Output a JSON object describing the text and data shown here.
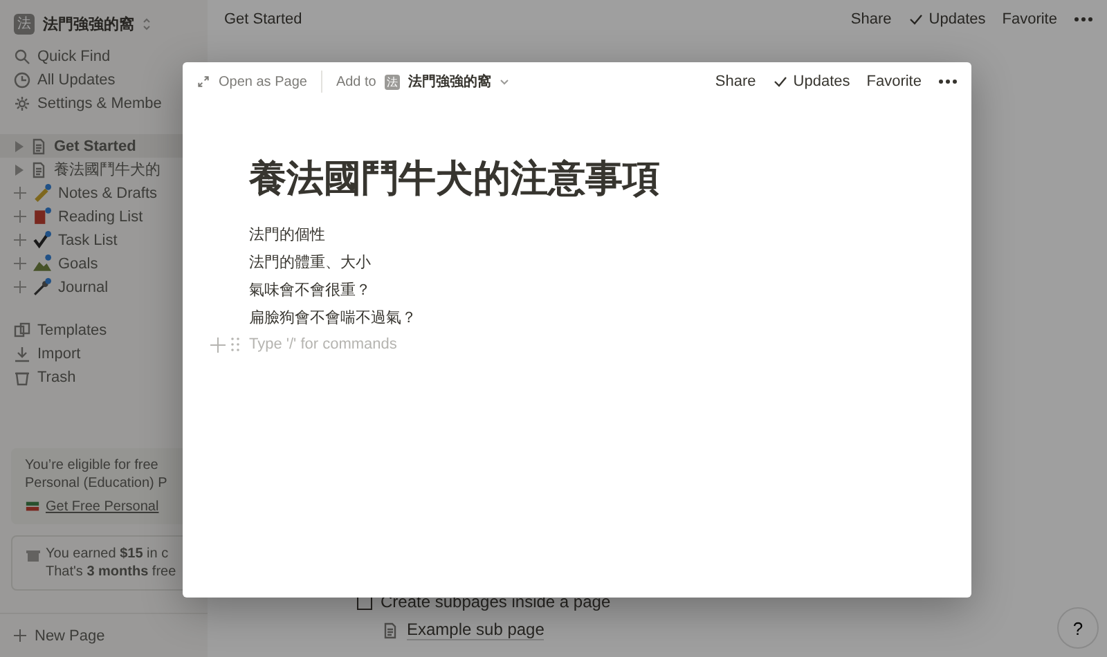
{
  "sidebar": {
    "workspace": {
      "initial": "法",
      "name": "法門強強的窩"
    },
    "nav": [
      {
        "kind": "search",
        "label": "Quick Find"
      },
      {
        "kind": "clock",
        "label": "All Updates"
      },
      {
        "kind": "gear",
        "label": "Settings & Membe"
      }
    ],
    "pages": [
      {
        "kind": "page",
        "label": "Get Started",
        "selected": true
      },
      {
        "kind": "page",
        "label": "養法國鬥牛犬的",
        "selected": false
      },
      {
        "kind": "notes",
        "label": "Notes & Drafts",
        "selected": false
      },
      {
        "kind": "books",
        "label": "Reading List",
        "selected": false
      },
      {
        "kind": "tasks",
        "label": "Task List",
        "selected": false
      },
      {
        "kind": "goals",
        "label": "Goals",
        "selected": false
      },
      {
        "kind": "journal",
        "label": "Journal",
        "selected": false
      }
    ],
    "tools": [
      {
        "kind": "templates",
        "label": "Templates"
      },
      {
        "kind": "import",
        "label": "Import"
      },
      {
        "kind": "trash",
        "label": "Trash"
      }
    ],
    "promo": {
      "lines": [
        "You’re eligible for free",
        "Personal (Education) P"
      ],
      "link": "Get Free Personal"
    },
    "credit": {
      "lines": [
        "You earned **$15** in c",
        "That's **3 months** free"
      ]
    },
    "new_page": "New Page"
  },
  "main": {
    "breadcrumb": "Get Started",
    "actions": [
      {
        "kind": "plain",
        "label": "Share"
      },
      {
        "kind": "check",
        "label": "Updates"
      },
      {
        "kind": "plain",
        "label": "Favorite"
      }
    ],
    "content": [
      {
        "kind": "todo",
        "checked": false,
        "text": "Create subpages inside a page"
      },
      {
        "kind": "subpage",
        "text": "Example sub page"
      }
    ],
    "help": "?"
  },
  "modal": {
    "open_as_page": "Open as Page",
    "add_to": "Add to",
    "workspace_initial": "法",
    "workspace": "法門強強的窩",
    "actions": [
      {
        "kind": "plain",
        "label": "Share"
      },
      {
        "kind": "check",
        "label": "Updates"
      },
      {
        "kind": "plain",
        "label": "Favorite"
      }
    ],
    "title": "養法國鬥牛犬的注意事項",
    "lines": [
      "法門的個性",
      "法門的體重、大小",
      "氣味會不會很重？",
      "扁臉狗會不會喘不過氣？"
    ],
    "placeholder": "Type '/' for commands"
  }
}
